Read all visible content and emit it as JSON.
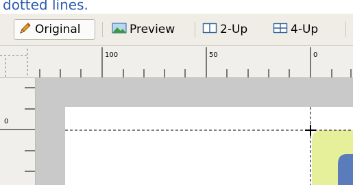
{
  "caption": {
    "text": "dotted lines."
  },
  "tabs": [
    {
      "label": "Original",
      "icon": "pencil-icon"
    },
    {
      "label": "Preview",
      "icon": "landscape-icon"
    },
    {
      "label": "2-Up",
      "icon": "two-up-icon"
    },
    {
      "label": "4-Up",
      "icon": "four-up-icon"
    }
  ],
  "ruler": {
    "top_labels": [
      "100",
      "50",
      "0"
    ],
    "left_labels": [
      "0"
    ]
  },
  "colors": {
    "caption": "#2b5cb0",
    "canvas_gray": "#c9c9c9",
    "shape_yellow": "#e6ef9a",
    "shape_blue": "#5a7cba"
  }
}
